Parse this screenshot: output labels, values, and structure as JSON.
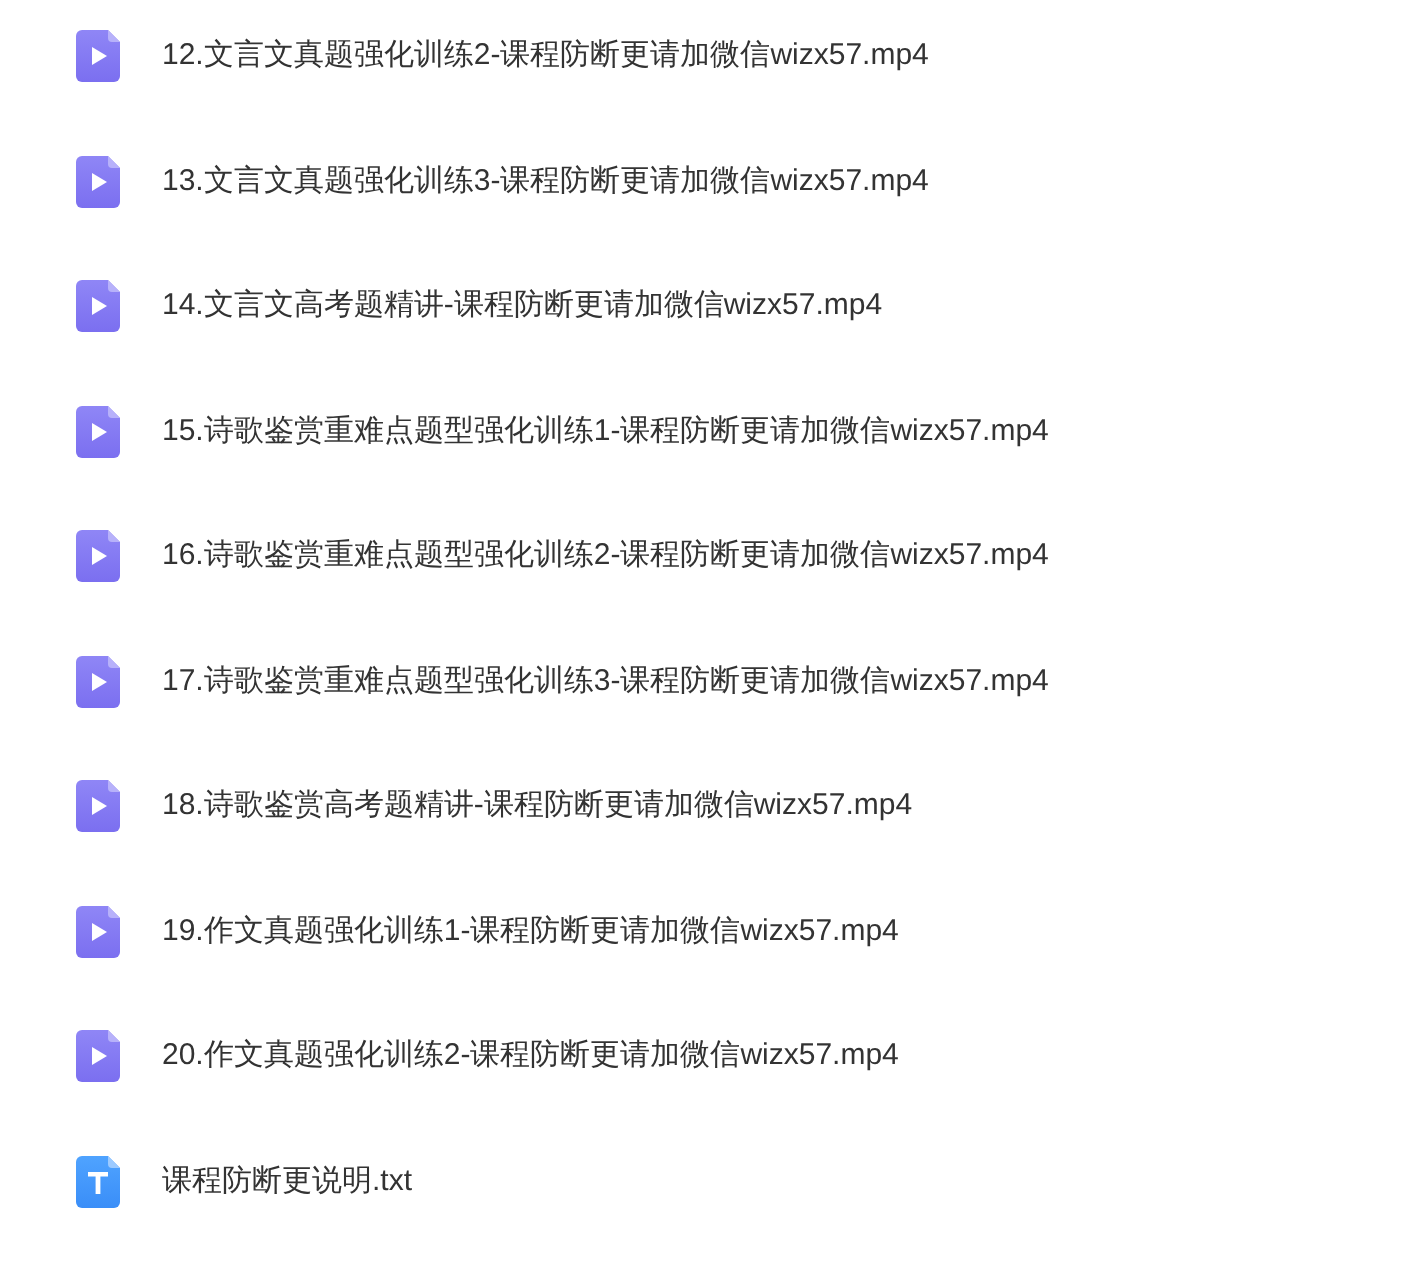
{
  "files": [
    {
      "kind": "video",
      "name": "12.文言文真题强化训练2-课程防断更请加微信wizx57.mp4"
    },
    {
      "kind": "video",
      "name": "13.文言文真题强化训练3-课程防断更请加微信wizx57.mp4"
    },
    {
      "kind": "video",
      "name": "14.文言文高考题精讲-课程防断更请加微信wizx57.mp4"
    },
    {
      "kind": "video",
      "name": "15.诗歌鉴赏重难点题型强化训练1-课程防断更请加微信wizx57.mp4"
    },
    {
      "kind": "video",
      "name": "16.诗歌鉴赏重难点题型强化训练2-课程防断更请加微信wizx57.mp4"
    },
    {
      "kind": "video",
      "name": "17.诗歌鉴赏重难点题型强化训练3-课程防断更请加微信wizx57.mp4"
    },
    {
      "kind": "video",
      "name": "18.诗歌鉴赏高考题精讲-课程防断更请加微信wizx57.mp4"
    },
    {
      "kind": "video",
      "name": "19.作文真题强化训练1-课程防断更请加微信wizx57.mp4"
    },
    {
      "kind": "video",
      "name": "20.作文真题强化训练2-课程防断更请加微信wizx57.mp4"
    },
    {
      "kind": "text",
      "name": "课程防断更说明.txt"
    }
  ]
}
